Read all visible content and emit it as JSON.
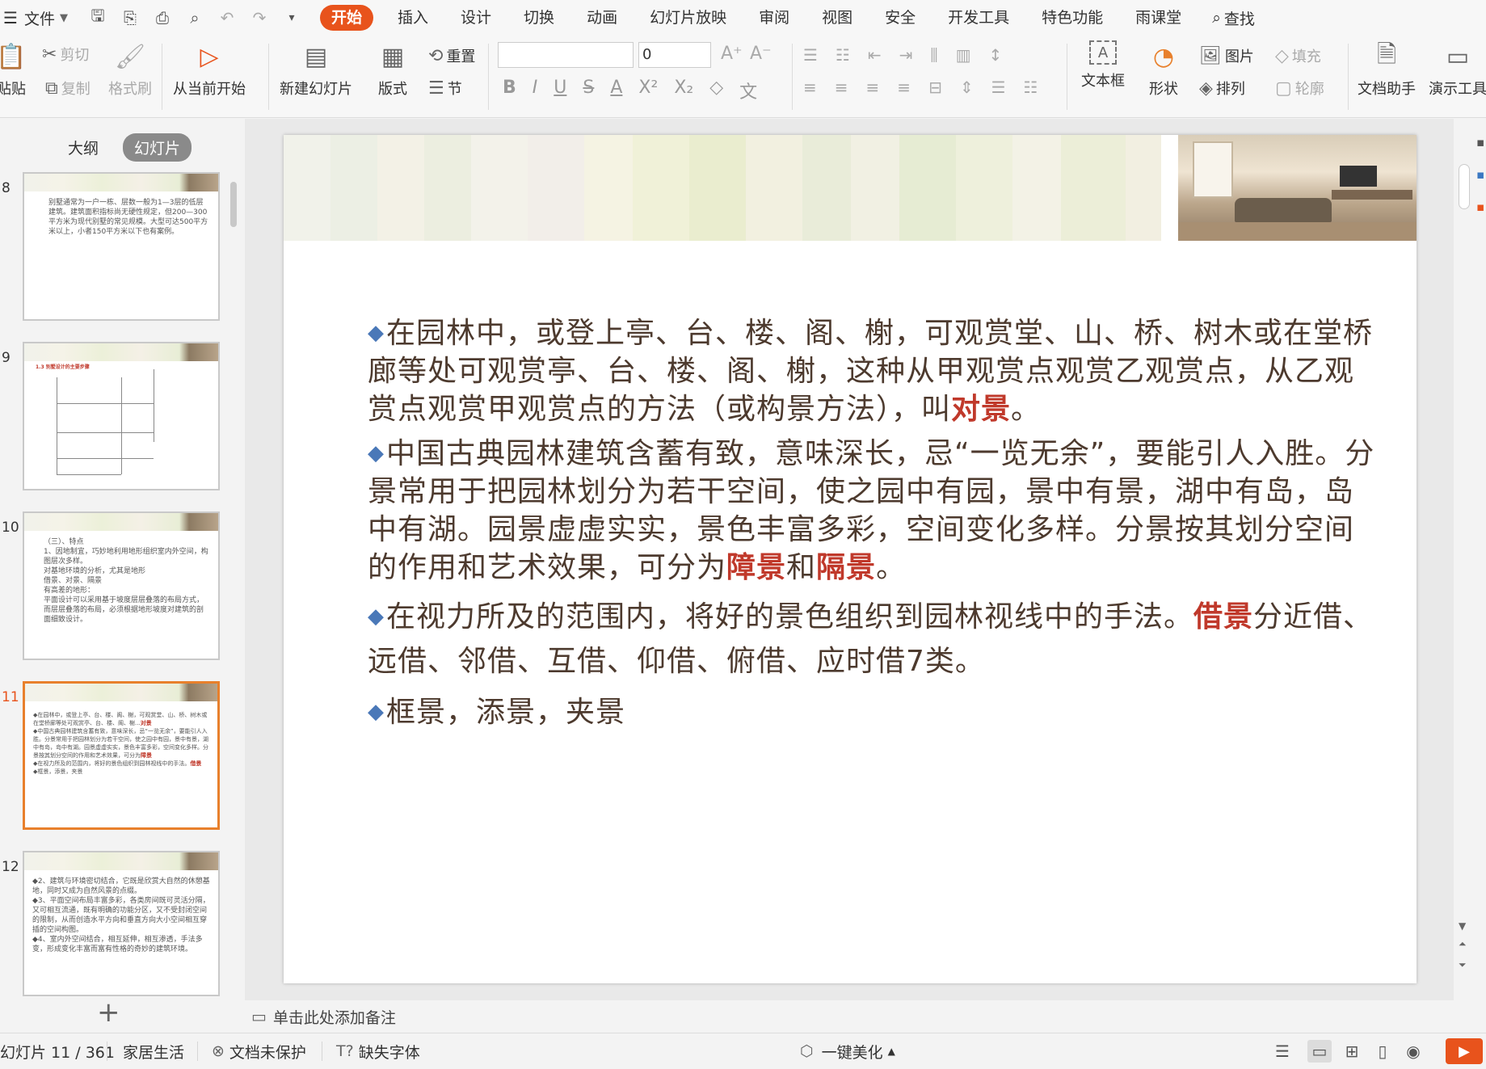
{
  "menubar": {
    "file_label": "文件",
    "tabs": [
      {
        "label": "开始"
      },
      {
        "label": "插入"
      },
      {
        "label": "设计"
      },
      {
        "label": "切换"
      },
      {
        "label": "动画"
      },
      {
        "label": "幻灯片放映"
      },
      {
        "label": "审阅"
      },
      {
        "label": "视图"
      },
      {
        "label": "安全"
      },
      {
        "label": "开发工具"
      },
      {
        "label": "特色功能"
      },
      {
        "label": "雨课堂"
      }
    ],
    "search_label": "查找"
  },
  "ribbon": {
    "paste": "贴贴",
    "cut": "剪切",
    "copy": "复制",
    "format_painter": "格式刷",
    "from_current": "从当前开始",
    "new_slide": "新建幻灯片",
    "layout": "版式",
    "reset": "重置",
    "section": "节",
    "font_size": "0",
    "textbox": "文本框",
    "shape": "形状",
    "picture": "图片",
    "arrange": "排列",
    "fill": "填充",
    "outline": "轮廓",
    "doc_assistant": "文档助手",
    "presentation_tools": "演示工具"
  },
  "panel": {
    "tab_outline": "大纲",
    "tab_slides": "幻灯片"
  },
  "thumbnails": [
    {
      "num": "8",
      "text": "别墅通常为一户一栋、层数一般为1—3层的低层建筑。建筑面积指标尚无硬性规定，但200—300平方米为现代别墅的常见规模。大型可达500平方米以上，小者150平方米以下也有案例。"
    },
    {
      "num": "9",
      "title": "1.3 别墅设计的主要步骤"
    },
    {
      "num": "10",
      "text": "（三）、特点\n1、因地制宜，巧妙地利用地形组织室内外空间，构图层次多样。\n对基地环境的分析，尤其是地形\n借景、对景、隔景\n有高差的地形：\n平面设计可以采用基于坡度层层叠落的布局方式，而层层叠落的布局，必须根据地形坡度对建筑的剖面细致设计。"
    },
    {
      "num": "11",
      "text": "在园林中，或登上亭、台、楼、阁、榭，可观赏堂、山、桥、树木或在堂桥廊等处可观赏亭、台、楼、阁、榭..."
    },
    {
      "num": "12",
      "text": "◆2、建筑与环境密切结合，它既是欣赏大自然的休憩基地，同时又成为自然风景的点缀。\n◆3、平面空间布局丰富多彩，各类房间既可灵活分隔，又可相互流通，既有明确的功能分区，又不受封闭空间的限制，从而创造水平方向和垂直方向大小空间相互穿插的空间构图。\n◆4、室内外空间结合，相互延伸，相互渗透，手法多变，形成变化丰富而富有性格的奇妙的建筑环境。"
    }
  ],
  "slide": {
    "p1_text": "在园林中，或登上亭、台、楼、阁、榭，可观赏堂、山、桥、树木或在堂桥廊等处可观赏亭、台、楼、阁、榭，这种从甲观赏点观赏乙观赏点，从乙观赏点观赏甲观赏点的方法（或构景方法），叫",
    "p1_hl": "对景",
    "p1_end": "。",
    "p2_text": "中国古典园林建筑含蓄有致，意味深长，忌“一览无余”，要能引人入胜。分景常用于把园林划分为若干空间，使之园中有园，景中有景，湖中有岛，岛中有湖。园景虚虚实实，景色丰富多彩，空间变化多样。分景按其划分空间的作用和艺术效果，可分为",
    "p2_hl1": "障景",
    "p2_mid": "和",
    "p2_hl2": "隔景",
    "p2_end": "。",
    "p3_text": "在视力所及的范围内，将好的景色组织到园林视线中的手法。",
    "p3_hl": "借景",
    "p3_end": "分近借、远借、邻借、互借、仰借、俯借、应时借7类。",
    "p4_text": "框景，添景，夹景"
  },
  "notes_placeholder": "单击此处添加备注",
  "statusbar": {
    "slide_counter": "幻灯片 11 / 361",
    "theme": "家居生活",
    "protect": "文档未保护",
    "missing_font": "缺失字体",
    "beautify": "一键美化"
  },
  "colors": {
    "accent": "#e8531c",
    "highlight": "#c0392b",
    "body_text": "#4d3a2e",
    "bullet": "#4a78b8"
  }
}
